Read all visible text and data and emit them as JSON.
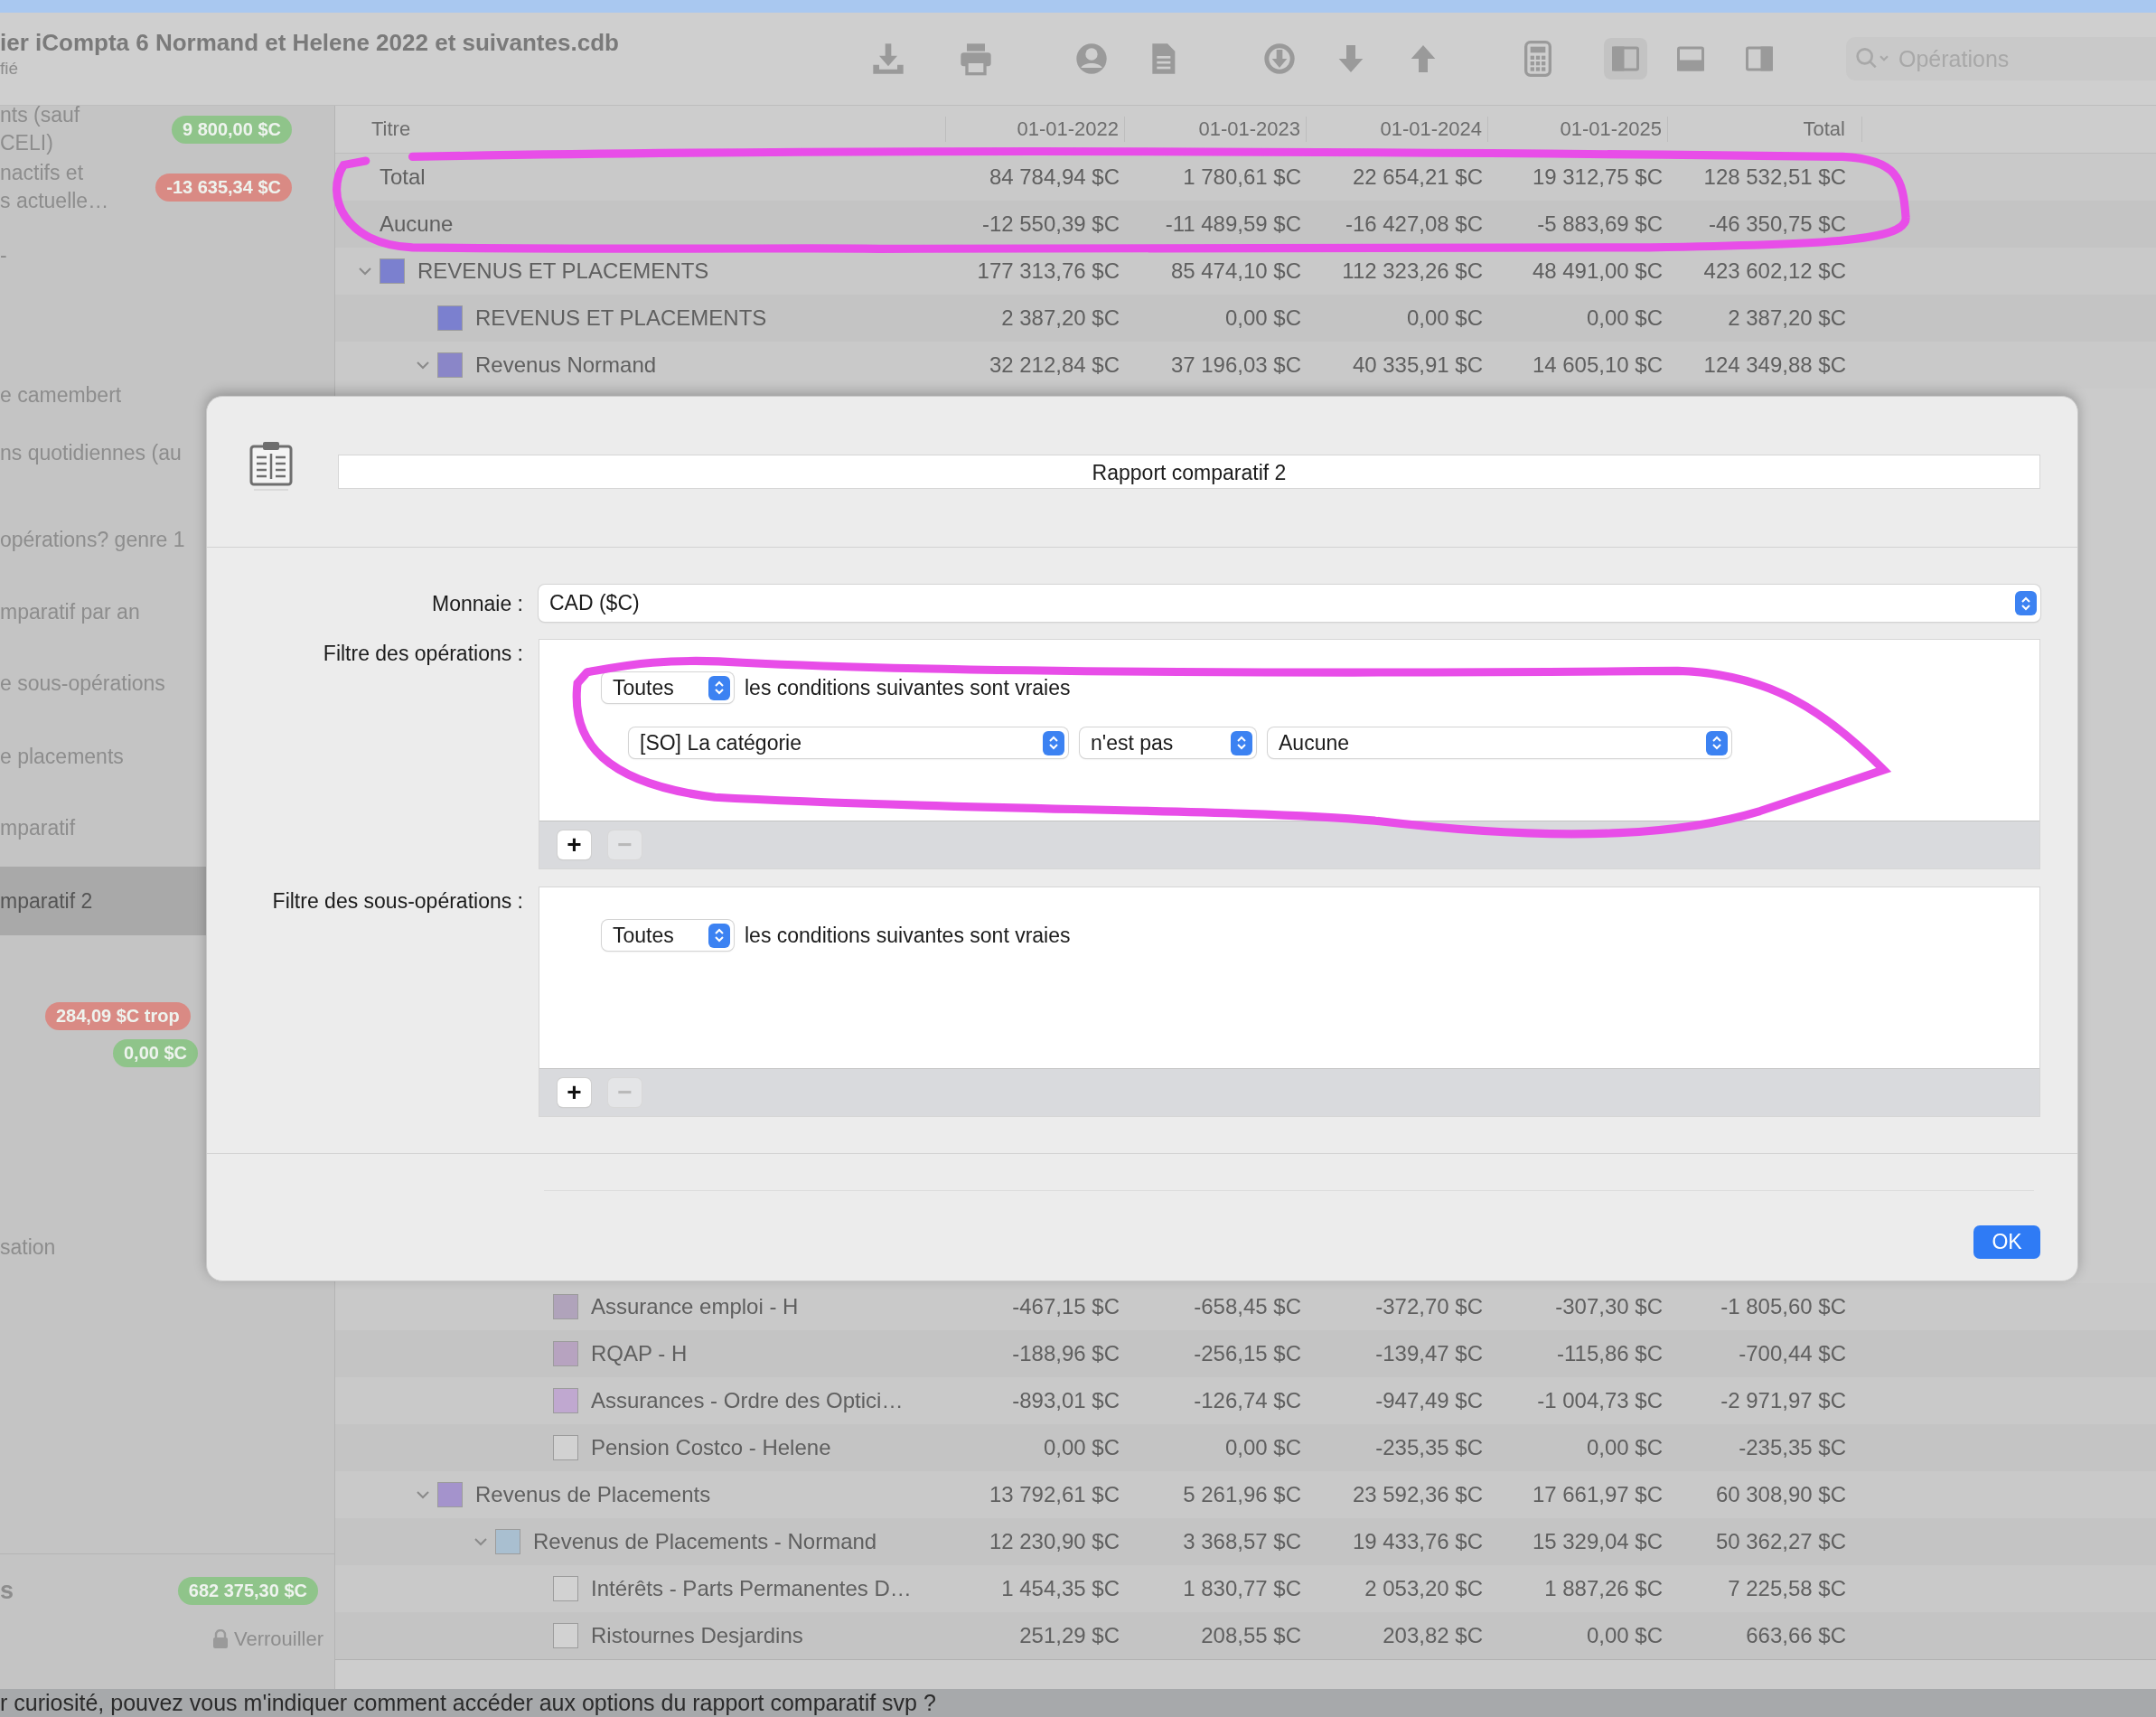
{
  "window": {
    "title": "ier iCompta 6 Normand et Helene 2022 et suivantes.cdb",
    "subtitle": "fié"
  },
  "toolbar": {
    "view_toggles": [
      {
        "selected": true
      },
      {
        "selected": false
      },
      {
        "selected": false
      }
    ],
    "search": {
      "placeholder": "Opérations"
    }
  },
  "sidebar": {
    "items": [
      {
        "lines": [
          "nts (sauf",
          "CELI)"
        ],
        "badges": [
          {
            "text": "9 800,00 $C",
            "color": "#8fc48a"
          }
        ],
        "selected": false
      },
      {
        "lines": [
          "nactifs et",
          "s actuelle…"
        ],
        "badges": [
          {
            "text": "-13 635,34 $C",
            "color": "#d98a84"
          }
        ],
        "selected": false
      },
      {
        "lines": [
          "-"
        ],
        "selected": false
      },
      {
        "lines": [
          "e camembert"
        ],
        "selected": false
      },
      {
        "lines": [
          "ns quotidiennes (au"
        ],
        "selected": false
      },
      {
        "lines": [
          "opérations? genre 1"
        ],
        "selected": false
      },
      {
        "lines": [
          "mparatif par an"
        ],
        "selected": false
      },
      {
        "lines": [
          "e sous-opérations"
        ],
        "selected": false
      },
      {
        "lines": [
          "e placements"
        ],
        "selected": false
      },
      {
        "lines": [
          "mparatif"
        ],
        "selected": false
      },
      {
        "lines": [
          "mparatif 2"
        ],
        "selected": true
      },
      {
        "badges": [
          {
            "text": "284,09 $C trop",
            "color": "#d98a84"
          },
          {
            "text": "0,00 $C",
            "color": "#8fc48a"
          }
        ],
        "selected": false
      },
      {
        "lines": [
          "sation"
        ],
        "selected": false
      }
    ],
    "footer": {
      "label": "s",
      "badge": {
        "text": "682 375,30 $C",
        "color": "#8fc48a"
      },
      "lock_button": "Verrouiller"
    }
  },
  "table": {
    "columns": [
      "Titre",
      "01-01-2022",
      "01-01-2023",
      "01-01-2024",
      "01-01-2025",
      "Total"
    ],
    "rows": [
      {
        "title": "Total",
        "values": [
          "84 784,94 $C",
          "1 780,61 $C",
          "22 654,21 $C",
          "19 312,75 $C",
          "128 532,51 $C"
        ]
      },
      {
        "title": "Aucune",
        "values": [
          "-12 550,39 $C",
          "-11 489,59 $C",
          "-16 427,08 $C",
          "-5 883,69 $C",
          "-46 350,75 $C"
        ]
      },
      {
        "title": "REVENUS ET PLACEMENTS",
        "color": "#7b80cf",
        "expanded": true,
        "values": [
          "177 313,76 $C",
          "85 474,10 $C",
          "112 323,26 $C",
          "48 491,00 $C",
          "423 602,12 $C"
        ],
        "children": [
          {
            "title": "REVENUS ET PLACEMENTS",
            "color": "#7b80cf",
            "values": [
              "2 387,20 $C",
              "0,00 $C",
              "0,00 $C",
              "0,00 $C",
              "2 387,20 $C"
            ]
          },
          {
            "title": "Revenus Normand",
            "color": "#8a86c8",
            "expanded": true,
            "values": [
              "32 212,84 $C",
              "37 196,03 $C",
              "40 335,91 $C",
              "14 605,10 $C",
              "124 349,88 $C"
            ],
            "children": [
              {
                "children": [
                  {
                    "title": "Assurance emploi - H",
                    "color": "#b0a3bb",
                    "values": [
                      "-467,15 $C",
                      "-658,45 $C",
                      "-372,70 $C",
                      "-307,30 $C",
                      "-1 805,60 $C"
                    ]
                  },
                  {
                    "title": "RQAP - H",
                    "color": "#b7a3c0",
                    "values": [
                      "-188,96 $C",
                      "-256,15 $C",
                      "-139,47 $C",
                      "-115,86 $C",
                      "-700,44 $C"
                    ]
                  },
                  {
                    "title": "Assurances - Ordre des Optici…",
                    "color": "#c0a8d0",
                    "values": [
                      "-893,01 $C",
                      "-126,74 $C",
                      "-947,49 $C",
                      "-1 004,73 $C",
                      "-2 971,97 $C"
                    ]
                  },
                  {
                    "title": "Pension Costco - Helene",
                    "color": "#d2d2d2",
                    "values": [
                      "0,00 $C",
                      "0,00 $C",
                      "-235,35 $C",
                      "0,00 $C",
                      "-235,35 $C"
                    ]
                  }
                ]
              }
            ]
          },
          {
            "title": "Revenus de Placements",
            "color": "#a493cc",
            "expanded": true,
            "values": [
              "13 792,61 $C",
              "5 261,96 $C",
              "23 592,36 $C",
              "17 661,97 $C",
              "60 308,90 $C"
            ],
            "children": [
              {
                "title": "Revenus de Placements - Normand",
                "color": "#a9bfd0",
                "expanded": true,
                "values": [
                  "12 230,90 $C",
                  "3 368,57 $C",
                  "19 433,76 $C",
                  "15 329,04 $C",
                  "50 362,27 $C"
                ],
                "children": [
                  {
                    "title": "Intérêts - Parts Permanentes D…",
                    "color": "#d2d2d2",
                    "values": [
                      "1 454,35 $C",
                      "1 830,77 $C",
                      "2 053,20 $C",
                      "1 887,26 $C",
                      "7 225,58 $C"
                    ]
                  },
                  {
                    "title": "Ristournes Desjardins",
                    "color": "#d2d2d2",
                    "values": [
                      "251,29 $C",
                      "208,55 $C",
                      "203,82 $C",
                      "0,00 $C",
                      "663,66 $C"
                    ]
                  }
                ]
              }
            ]
          }
        ]
      }
    ]
  },
  "dialog": {
    "name_field": "Rapport comparatif 2",
    "currency": {
      "label": "Monnaie :",
      "value": "CAD ($C)"
    },
    "filters": [
      {
        "label": "Filtre des opérations :",
        "match": "Toutes",
        "text": "les conditions suivantes sont vraies",
        "conditions": [
          {
            "field": "[SO] La catégorie",
            "operator": "n'est pas",
            "value": "Aucune"
          }
        ],
        "add_button": {
          "label": "+",
          "disabled": false
        },
        "remove_button": {
          "label": "−",
          "disabled": true
        }
      },
      {
        "label": "Filtre des sous-opérations :",
        "match": "Toutes",
        "text": "les conditions suivantes sont vraies",
        "add_button": {
          "label": "+",
          "disabled": false
        },
        "remove_button": {
          "label": "−",
          "disabled": true
        }
      }
    ],
    "ok_button": "OK"
  },
  "background_message": "r curiosité, pouvez vous m'indiquer comment accéder aux options du rapport comparatif svp ?"
}
